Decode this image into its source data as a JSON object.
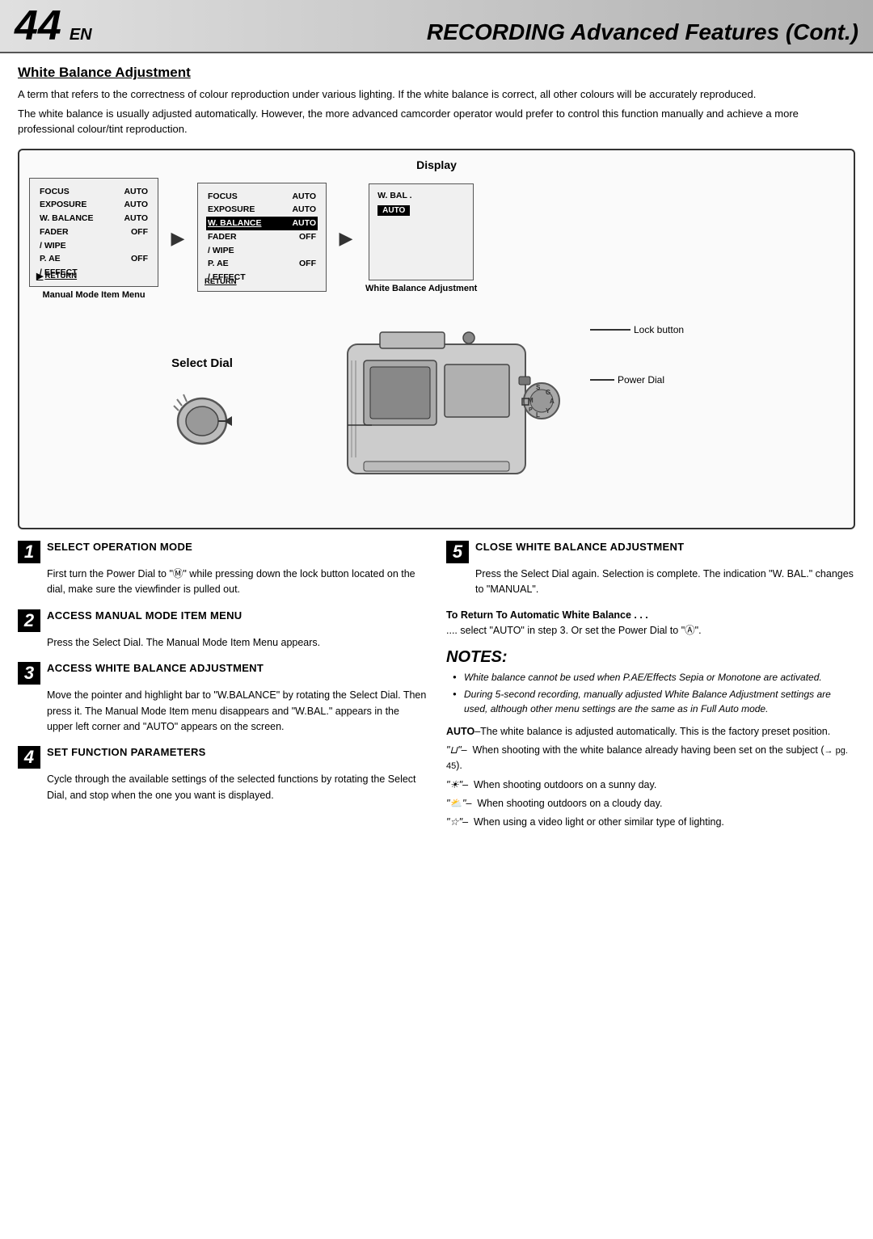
{
  "header": {
    "page_number": "44",
    "en_suffix": "EN",
    "title": "RECORDING Advanced Features (Cont.)"
  },
  "white_balance_section": {
    "title": "White Balance Adjustment",
    "intro_p1": "A term that refers to the correctness of colour reproduction under various lighting. If the white balance is correct, all other colours will be accurately reproduced.",
    "intro_p2": "The white balance is usually adjusted automatically. However, the more advanced camcorder operator would prefer to control this function manually and achieve a more professional colour/tint reproduction."
  },
  "display_section": {
    "title": "Display",
    "screen1": {
      "rows": [
        {
          "label": "FOCUS",
          "value": "AUTO"
        },
        {
          "label": "EXPOSURE",
          "value": "AUTO"
        },
        {
          "label": "W. BALANCE",
          "value": "AUTO"
        },
        {
          "label": "FADER",
          "value": "OFF"
        },
        {
          "label": "/ WIPE",
          "value": ""
        },
        {
          "label": "P. AE",
          "value": "OFF"
        },
        {
          "label": "/ EFFECT",
          "value": ""
        }
      ],
      "return_label": "RETURN",
      "caption": "Manual Mode Item Menu"
    },
    "screen2": {
      "rows": [
        {
          "label": "FOCUS",
          "value": "AUTO"
        },
        {
          "label": "EXPOSURE",
          "value": "AUTO"
        },
        {
          "label": "W. BALANCE",
          "value": "AUTO",
          "highlighted": true
        },
        {
          "label": "FADER",
          "value": "OFF"
        },
        {
          "label": "/ WIPE",
          "value": ""
        },
        {
          "label": "P. AE",
          "value": "OFF"
        },
        {
          "label": "/ EFFECT",
          "value": ""
        }
      ],
      "return_label": "RETURN",
      "caption": ""
    },
    "screen3": {
      "wbal_label": "W. BAL .",
      "auto_badge": "AUTO",
      "caption": "White Balance Adjustment"
    }
  },
  "camera_labels": {
    "select_dial": "Select Dial",
    "lock_button": "Lock button",
    "power_dial": "Power Dial"
  },
  "steps": [
    {
      "number": "1",
      "title": "SELECT OPERATION MODE",
      "body": "First turn the Power Dial to \"Ⓜ\" while pressing down the lock button located on the dial, make sure the viewfinder is pulled out."
    },
    {
      "number": "2",
      "title": "ACCESS MANUAL MODE ITEM MENU",
      "body": "Press the Select Dial. The Manual Mode Item Menu appears."
    },
    {
      "number": "3",
      "title": "ACCESS WHITE BALANCE ADJUSTMENT",
      "body": "Move the pointer and highlight bar to \"W.BALANCE\" by rotating the Select Dial. Then press it. The Manual Mode Item menu disappears and \"W.BAL.\" appears in the upper left corner and \"AUTO\" appears on the screen."
    },
    {
      "number": "4",
      "title": "SET FUNCTION PARAMETERS",
      "body": "Cycle through the available settings of the selected functions by rotating the Select Dial, and stop when the one you want is displayed."
    },
    {
      "number": "5",
      "title": "CLOSE WHITE BALANCE ADJUSTMENT",
      "body": "Press the Select Dial again. Selection is complete. The indication \"W. BAL.\" changes to  \"MANUAL\"."
    }
  ],
  "return_to_auto": {
    "title": "To Return To Automatic White Balance . . .",
    "body": ".... select \"AUTO\" in step 3. Or set the Power Dial to \"Ⓐ\"."
  },
  "notes": {
    "title": "NOTES",
    "items": [
      "White balance cannot be used when P.AE/Effects Sepia or Monotone are activated.",
      "During 5-second recording, manually adjusted White Balance Adjustment settings are used, although other menu settings are the same as in Full Auto mode."
    ]
  },
  "auto_section": {
    "auto_text": "AUTO",
    "auto_desc": "–The white balance is adjusted automatically. This is the factory preset position.",
    "icon_items": [
      {
        "icon": "\"⊔\"",
        "desc": "–  When shooting with the white balance already having been set on the subject (→ pg. 45)."
      },
      {
        "icon": "\"☀\"",
        "desc": "–  When shooting outdoors on a sunny day."
      },
      {
        "icon": "\"⛅\"",
        "desc": "–  When shooting outdoors on a cloudy day."
      },
      {
        "icon": "\"☆\"",
        "desc": "–  When using a video light or other similar type of lighting."
      }
    ]
  }
}
